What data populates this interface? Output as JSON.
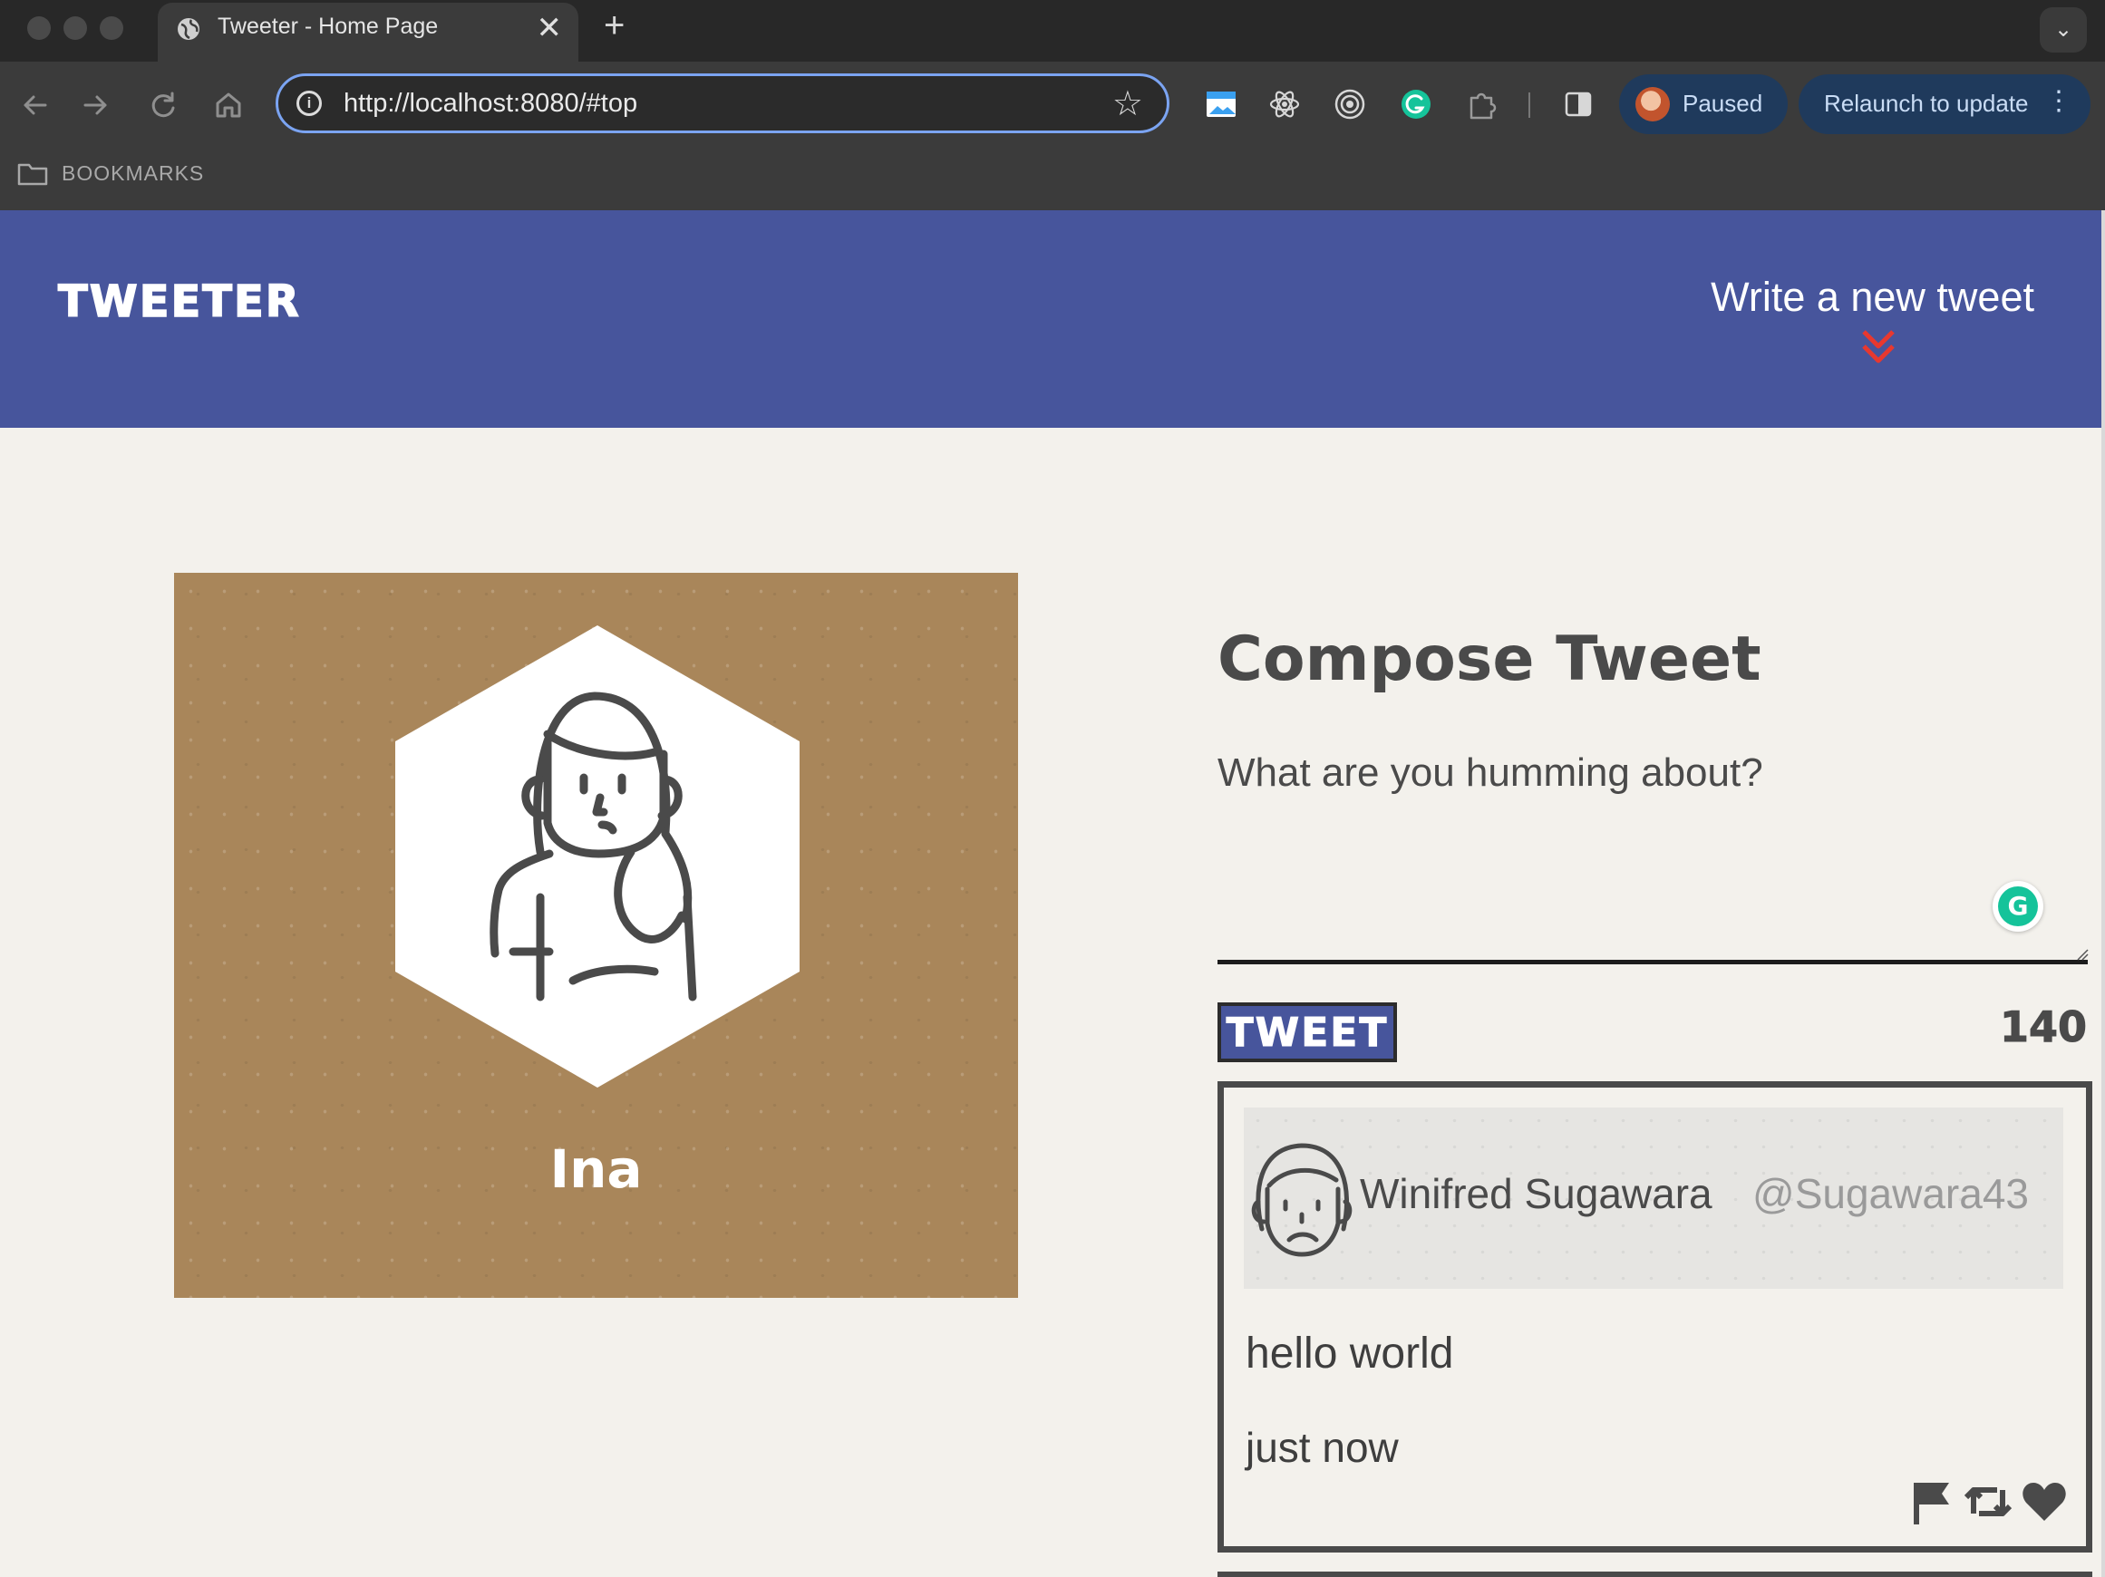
{
  "browser": {
    "tab_title": "Tweeter - Home Page",
    "tab_close": "✕",
    "new_tab": "+",
    "tab_menu": "⌄",
    "url": "http://localhost:8080/#top",
    "profile_status": "Paused",
    "relaunch_label": "Relaunch to update",
    "bookmarks_label": "BOOKMARKS"
  },
  "app": {
    "brand": "TWEETER",
    "write_new_label": "Write a new tweet",
    "accent_color": "#47559c"
  },
  "profile": {
    "name": "Ina"
  },
  "compose": {
    "title": "Compose Tweet",
    "placeholder": "What are you humming about?",
    "submit_label": "TWEET",
    "counter": "140"
  },
  "tweets": [
    {
      "name": "Winifred Sugawara",
      "handle": "@Sugawara43",
      "text": "hello world",
      "time": "just now"
    }
  ],
  "icons": [
    "globe-icon",
    "back-icon",
    "forward-icon",
    "reload-icon",
    "home-icon",
    "info-icon",
    "bookmark-star-icon",
    "extension-icons",
    "folder-icon",
    "double-chevron-down-icon",
    "grammarly-icon",
    "flag-icon",
    "retweet-icon",
    "heart-icon"
  ]
}
